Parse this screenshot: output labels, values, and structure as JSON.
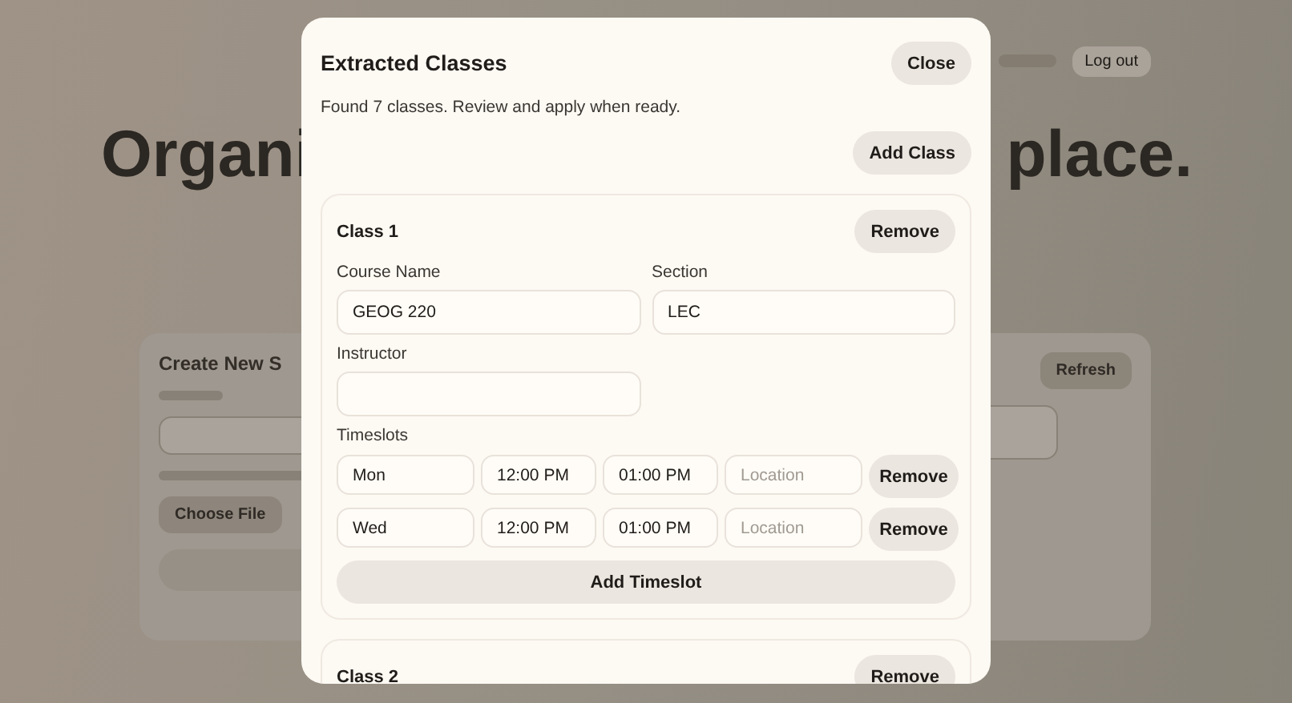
{
  "background": {
    "nav_button": "Log out",
    "headline_left": "Organi",
    "headline_right": "place.",
    "left_card": {
      "title": "Create New S",
      "choose_file": "Choose File"
    },
    "right_card": {
      "button": "Refresh"
    }
  },
  "modal": {
    "title": "Extracted Classes",
    "close": "Close",
    "message": "Found 7 classes. Review and apply when ready.",
    "add_class": "Add Class",
    "classes": [
      {
        "title": "Class 1",
        "remove": "Remove",
        "course_name": {
          "label": "Course Name",
          "value": "GEOG 220"
        },
        "section": {
          "label": "Section",
          "value": "LEC"
        },
        "instructor": {
          "label": "Instructor"
        },
        "timeslots_label": "Timeslots",
        "timeslots": [
          {
            "day": "Mon",
            "start": "12:00 PM",
            "end": "01:00 PM",
            "location_placeholder": "Location",
            "remove": "Remove"
          },
          {
            "day": "Wed",
            "start": "12:00 PM",
            "end": "01:00 PM",
            "location_placeholder": "Location",
            "remove": "Remove"
          }
        ],
        "add_timeslot": "Add Timeslot"
      },
      {
        "title": "Class 2",
        "remove": "Remove"
      }
    ]
  }
}
